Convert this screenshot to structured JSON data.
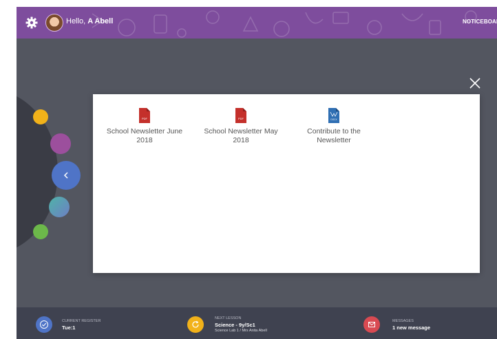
{
  "header": {
    "greeting_prefix": "Hello, ",
    "user_name": "A Abell",
    "noticeboard_label": "NOTICEBOARD"
  },
  "files": [
    {
      "icon": "pdf-file-icon",
      "type_label": "PDF",
      "label": "School Newsletter June 2018"
    },
    {
      "icon": "pdf-file-icon",
      "type_label": "PDF",
      "label": "School Newsletter May 2018"
    },
    {
      "icon": "docx-file-icon",
      "type_label": "DOCX",
      "label": "Contribute to the Newsletter"
    }
  ],
  "footer": {
    "register": {
      "label": "CURRENT REGISTER",
      "value": "Tue:1"
    },
    "lesson": {
      "label": "NEXT LESSON",
      "value": "Science - 9y/Sc1",
      "detail": "Science Lab 1 / Mrs Anita Abell"
    },
    "messages": {
      "label": "MESSAGES",
      "value": "1 new message"
    }
  },
  "colors": {
    "header": "#7e4d9d",
    "background": "#535660",
    "footer": "#3f4250",
    "pdf": "#c4302b",
    "docx": "#2f6fb3",
    "register": "#4f74c7",
    "lesson": "#f2b21a",
    "messages": "#d94a52"
  }
}
